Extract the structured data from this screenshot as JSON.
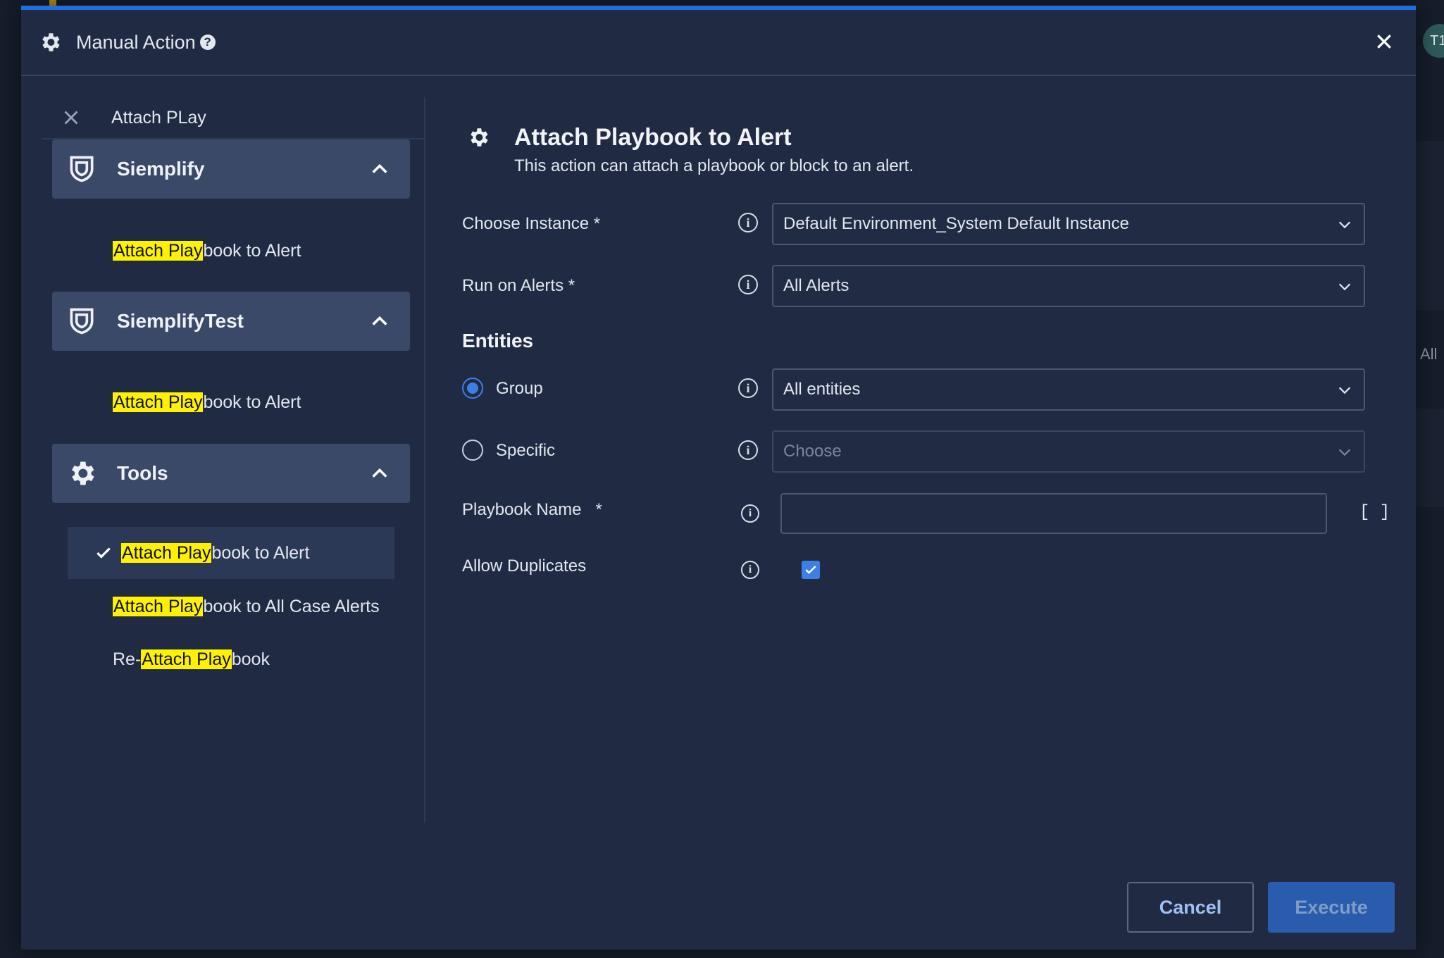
{
  "backdrop": {
    "avatar_initials": "T1",
    "side_text": "All"
  },
  "modal": {
    "title": "Manual Action",
    "help_icon": "question-circle-icon",
    "close_icon": "close-icon"
  },
  "left_panel": {
    "search": {
      "value": "Attach PLay",
      "highlight": "Attach Play"
    },
    "groups": [
      {
        "name": "Siemplify",
        "icon": "shield-icon",
        "expanded": true,
        "actions": [
          {
            "pre": "",
            "mark": "Attach Play",
            "post": "book to Alert"
          }
        ]
      },
      {
        "name": "SiemplifyTest",
        "icon": "shield-icon",
        "expanded": true,
        "actions": [
          {
            "pre": "",
            "mark": "Attach Play",
            "post": "book to Alert"
          }
        ]
      },
      {
        "name": "Tools",
        "icon": "gear-icon",
        "expanded": true,
        "actions": [
          {
            "pre": "",
            "mark": "Attach Play",
            "post": "book to Alert",
            "selected": true
          },
          {
            "pre": "",
            "mark": "Attach Play",
            "post": "book to All Case Alerts"
          },
          {
            "pre": "Re-",
            "mark": "Attach Play",
            "post": "book"
          }
        ]
      }
    ]
  },
  "action": {
    "title": "Attach Playbook to Alert",
    "description": "This action can attach a playbook or block to an alert."
  },
  "form": {
    "choose_instance": {
      "label": "Choose Instance *",
      "value": "Default Environment_System Default Instance"
    },
    "run_on_alerts": {
      "label": "Run on Alerts *",
      "value": "All Alerts"
    },
    "entities": {
      "title": "Entities",
      "group": {
        "label": "Group",
        "checked": true,
        "value": "All entities"
      },
      "specific": {
        "label": "Specific",
        "checked": false,
        "placeholder": "Choose"
      }
    },
    "playbook_name": {
      "label": "Playbook Name",
      "required_mark": "*",
      "value": "",
      "brackets": "[ ]"
    },
    "allow_duplicates": {
      "label": "Allow Duplicates",
      "checked": true
    }
  },
  "footer": {
    "cancel_label": "Cancel",
    "execute_label": "Execute"
  },
  "colors": {
    "accent": "#1f6fe0",
    "highlight": "#fff200",
    "modal_bg": "#202b43",
    "group_bg": "#3b4969"
  }
}
